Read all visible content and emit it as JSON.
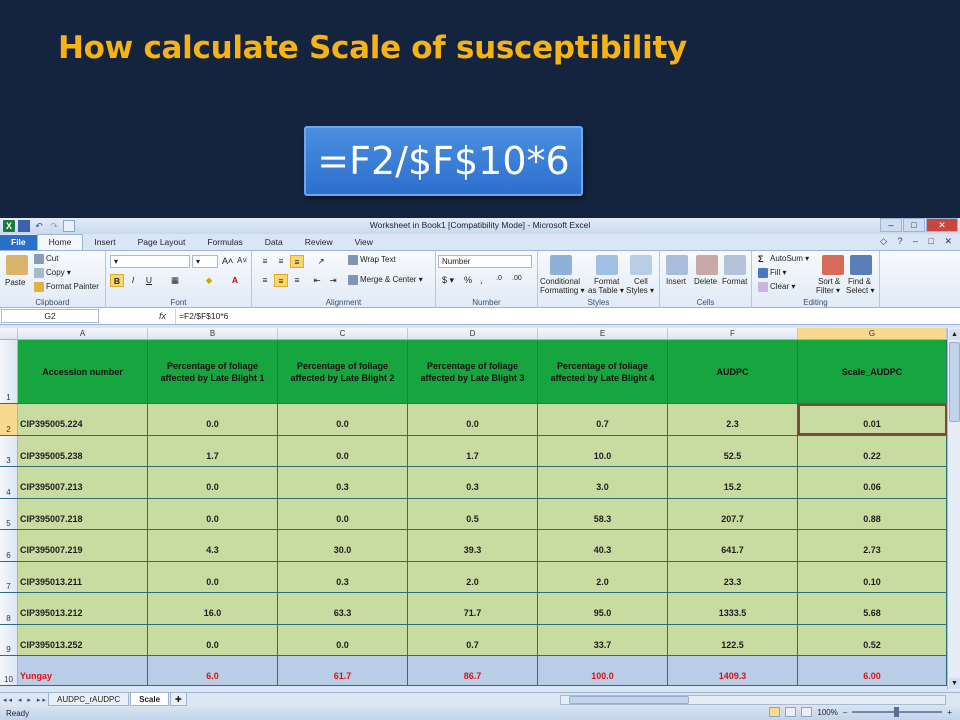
{
  "slide": {
    "title": "How calculate  Scale of susceptibility",
    "formula_display": "=F2/$F$10*6"
  },
  "window": {
    "title": "Worksheet in Book1  [Compatibility Mode]  -  Microsoft Excel",
    "controls": {
      "minimize": "–",
      "maximize": "□",
      "close": "✕"
    }
  },
  "ribbon_tabs": [
    "File",
    "Home",
    "Insert",
    "Page Layout",
    "Formulas",
    "Data",
    "Review",
    "View"
  ],
  "ribbon": {
    "clipboard": {
      "paste": "Paste",
      "cut": "Cut",
      "copy": "Copy ▾",
      "format_painter": "Format Painter",
      "label": "Clipboard"
    },
    "font": {
      "bold": "B",
      "italic": "I",
      "underline": "U",
      "grow": "A˄",
      "shrink": "A˅",
      "label": "Font"
    },
    "alignment": {
      "wrap": "Wrap Text",
      "merge": "Merge & Center ▾",
      "label": "Alignment"
    },
    "number": {
      "format": "Number",
      "currency": "$ ▾",
      "percent": "%",
      "comma": ",",
      "inc": ".0",
      "dec": ".00",
      "label": "Number"
    },
    "styles": {
      "conditional": "Conditional",
      "conditional2": "Formatting ▾",
      "format_table": "Format",
      "format_table2": "as Table ▾",
      "cell_styles": "Cell",
      "cell_styles2": "Styles ▾",
      "label": "Styles"
    },
    "cells": {
      "insert": "Insert",
      "delete": "Delete",
      "format": "Format",
      "label": "Cells"
    },
    "editing": {
      "autosum": "AutoSum ▾",
      "fill": "Fill ▾",
      "clear": "Clear ▾",
      "sort": "Sort &",
      "sort2": "Filter ▾",
      "find": "Find &",
      "find2": "Select ▾",
      "label": "Editing"
    }
  },
  "formula_bar": {
    "name_box": "G2",
    "fx": "fx",
    "formula": "=F2/$F$10*6"
  },
  "columns": [
    "A",
    "B",
    "C",
    "D",
    "E",
    "F",
    "G"
  ],
  "header_row": {
    "row": "1",
    "cells": [
      "Accession number",
      "Percentage of foliage affected by Late Blight 1",
      "Percentage of foliage affected by Late Blight 2",
      "Percentage of foliage affected by Late Blight 3",
      "Percentage of foliage affected by Late Blight 4",
      "AUDPC",
      "Scale_AUDPC"
    ]
  },
  "rows": [
    {
      "row": "2",
      "cells": [
        "CIP395005.224",
        "0.0",
        "0.0",
        "0.0",
        "0.7",
        "2.3",
        "0.01"
      ]
    },
    {
      "row": "3",
      "cells": [
        "CIP395005.238",
        "1.7",
        "0.0",
        "1.7",
        "10.0",
        "52.5",
        "0.22"
      ]
    },
    {
      "row": "4",
      "cells": [
        "CIP395007.213",
        "0.0",
        "0.3",
        "0.3",
        "3.0",
        "15.2",
        "0.06"
      ]
    },
    {
      "row": "5",
      "cells": [
        "CIP395007.218",
        "0.0",
        "0.0",
        "0.5",
        "58.3",
        "207.7",
        "0.88"
      ]
    },
    {
      "row": "6",
      "cells": [
        "CIP395007.219",
        "4.3",
        "30.0",
        "39.3",
        "40.3",
        "641.7",
        "2.73"
      ]
    },
    {
      "row": "7",
      "cells": [
        "CIP395013.211",
        "0.0",
        "0.3",
        "2.0",
        "2.0",
        "23.3",
        "0.10"
      ]
    },
    {
      "row": "8",
      "cells": [
        "CIP395013.212",
        "16.0",
        "63.3",
        "71.7",
        "95.0",
        "1333.5",
        "5.68"
      ]
    },
    {
      "row": "9",
      "cells": [
        "CIP395013.252",
        "0.0",
        "0.0",
        "0.7",
        "33.7",
        "122.5",
        "0.52"
      ]
    }
  ],
  "total_row": {
    "row": "10",
    "cells": [
      "Yungay",
      "6.0",
      "61.7",
      "86.7",
      "100.0",
      "1409.3",
      "6.00"
    ]
  },
  "sheet_tabs": [
    "AUDPC_rAUDPC",
    "Scale"
  ],
  "status": {
    "ready": "Ready",
    "zoom": "100%"
  },
  "colors": {
    "header_green": "#17a540",
    "data_green": "#c8dba0",
    "total_blue": "#b9cde6",
    "total_red": "#e01010",
    "title_gold": "#f5b316"
  }
}
